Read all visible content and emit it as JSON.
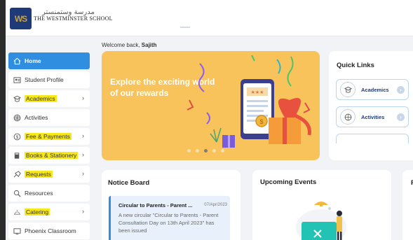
{
  "header": {
    "logo_letters": "WS",
    "school_name_arabic": "مدرسة وستمنستر",
    "school_name": "THE WESTMINSTER SCHOOL"
  },
  "welcome": {
    "prefix": "Welcome back,",
    "name": "Sajith"
  },
  "sidebar": {
    "items": [
      {
        "label": "Home",
        "icon": "home-icon",
        "active": true,
        "highlighted": false,
        "has_chevron": false
      },
      {
        "label": "Student Profile",
        "icon": "profile-icon",
        "active": false,
        "highlighted": false,
        "has_chevron": false
      },
      {
        "label": "Academics",
        "icon": "academics-icon",
        "active": false,
        "highlighted": true,
        "has_chevron": true
      },
      {
        "label": "Activities",
        "icon": "activities-icon",
        "active": false,
        "highlighted": false,
        "has_chevron": false
      },
      {
        "label": "Fee & Payments",
        "icon": "fee-icon",
        "active": false,
        "highlighted": true,
        "has_chevron": true
      },
      {
        "label": "Books & Stationery",
        "icon": "books-icon",
        "active": false,
        "highlighted": true,
        "has_chevron": true
      },
      {
        "label": "Requests",
        "icon": "requests-icon",
        "active": false,
        "highlighted": true,
        "has_chevron": true
      },
      {
        "label": "Resources",
        "icon": "resources-icon",
        "active": false,
        "highlighted": false,
        "has_chevron": false
      },
      {
        "label": "Catering",
        "icon": "catering-icon",
        "active": false,
        "highlighted": true,
        "has_chevron": true
      },
      {
        "label": "Phoenix Classroom",
        "icon": "classroom-icon",
        "active": false,
        "highlighted": false,
        "has_chevron": false
      }
    ]
  },
  "banner": {
    "title": "Explore the exciting world of our rewards",
    "slides": 5,
    "active_slide": 3,
    "colors": {
      "background": "#f8c35a"
    }
  },
  "quick_links": {
    "title": "Quick Links",
    "items": [
      {
        "label": "Academics",
        "icon": "academics-icon"
      },
      {
        "label": "Activities",
        "icon": "activities-icon"
      },
      {
        "label": "",
        "icon": ""
      }
    ]
  },
  "notice_board": {
    "title": "Notice Board",
    "notice": {
      "title": "Circular to Parents - Parent ...",
      "date": "07/Apr/2023",
      "body": "A new circular \"Circular to Parents - Parent Consultation Day on 13th April 2023\" has been issued"
    }
  },
  "upcoming_events": {
    "title": "Upcoming Events"
  },
  "third_panel": {
    "title_initial": "P"
  },
  "colors": {
    "accent": "#2f8ee0",
    "highlight": "#f7e81b",
    "brand": "#1f3a78"
  }
}
